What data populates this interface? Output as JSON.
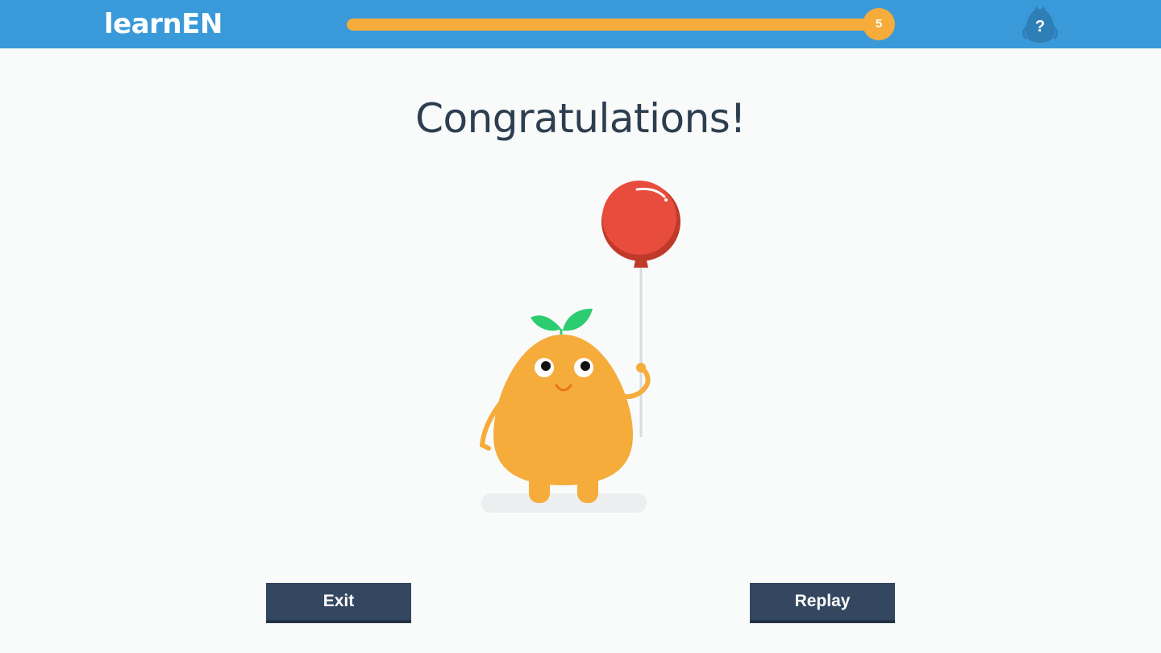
{
  "header": {
    "logo_text": "learnEN",
    "progress": {
      "fraction": 1.0,
      "badge_label": "5"
    },
    "help_label": "?",
    "bar_color": "#3a9ad9",
    "accent_color": "#f5ac3b"
  },
  "main": {
    "title": "Congratulations!",
    "illustration": "mascot-with-balloon"
  },
  "actions": {
    "exit_label": "Exit",
    "replay_label": "Replay",
    "button_color": "#344760"
  }
}
